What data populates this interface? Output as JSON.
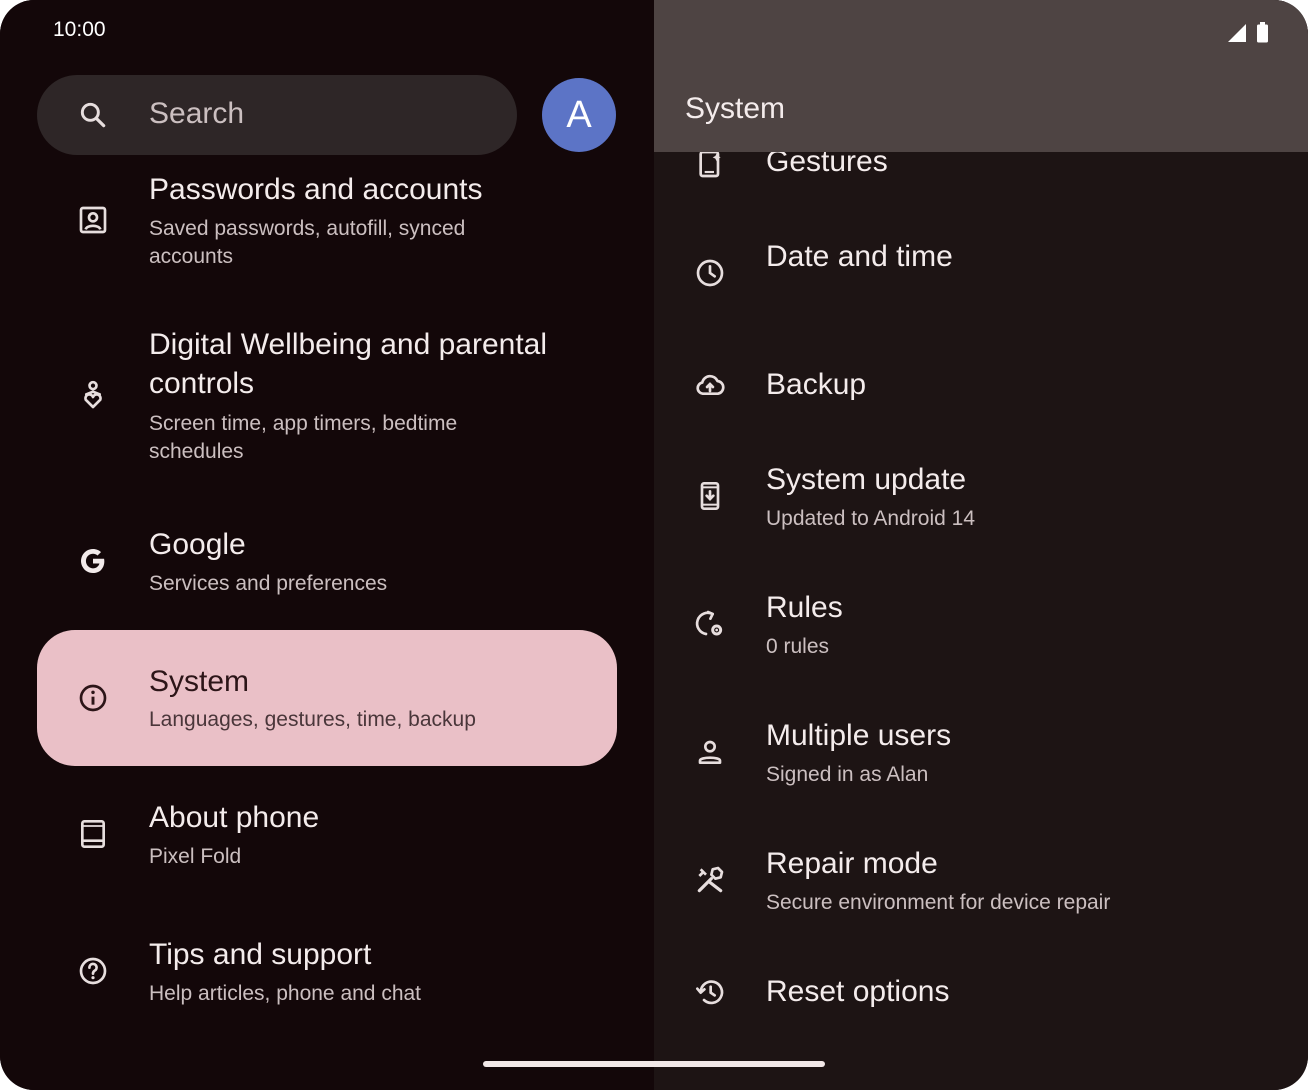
{
  "status_bar": {
    "time": "10:00",
    "icons": [
      "signal-icon",
      "battery-icon"
    ]
  },
  "search": {
    "placeholder": "Search",
    "avatar_letter": "A"
  },
  "left_list": [
    {
      "icon": "passwords-accounts-icon",
      "title": "Passwords and accounts",
      "subtitle": "Saved passwords, autofill, synced accounts"
    },
    {
      "icon": "digital-wellbeing-icon",
      "title": "Digital Wellbeing and parental controls",
      "subtitle": "Screen time, app timers, bedtime schedules"
    },
    {
      "icon": "google-icon",
      "title": "Google",
      "subtitle": "Services and preferences"
    },
    {
      "icon": "info-icon",
      "title": "System",
      "subtitle": "Languages, gestures, time, backup",
      "selected": true
    },
    {
      "icon": "tablet-icon",
      "title": "About phone",
      "subtitle": "Pixel Fold"
    },
    {
      "icon": "help-icon",
      "title": "Tips and support",
      "subtitle": "Help articles, phone and chat"
    }
  ],
  "right_pane": {
    "header_title": "System",
    "items": [
      {
        "icon": "gestures-icon",
        "title": "Gestures",
        "subtitle": ""
      },
      {
        "icon": "clock-icon",
        "title": "Date and time",
        "subtitle": ""
      },
      {
        "icon": "cloud-upload-icon",
        "title": "Backup",
        "subtitle": ""
      },
      {
        "icon": "system-update-icon",
        "title": "System update",
        "subtitle": "Updated to Android 14"
      },
      {
        "icon": "rules-icon",
        "title": "Rules",
        "subtitle": "0 rules"
      },
      {
        "icon": "person-icon",
        "title": "Multiple users",
        "subtitle": "Signed in as Alan"
      },
      {
        "icon": "repair-tools-icon",
        "title": "Repair mode",
        "subtitle": "Secure environment for device repair"
      },
      {
        "icon": "history-icon",
        "title": "Reset options",
        "subtitle": ""
      }
    ]
  },
  "colors": {
    "left_background": "#130709",
    "right_background": "#1d1414",
    "header_background": "#4e4443",
    "selected_item": "#eac0c7",
    "avatar": "#5c74c6",
    "search_bar": "#2e2627"
  }
}
